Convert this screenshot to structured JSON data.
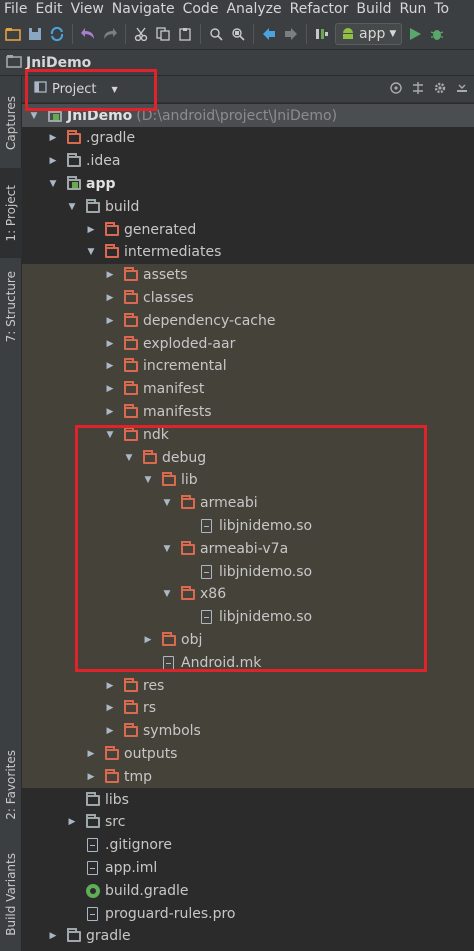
{
  "menu": [
    "File",
    "Edit",
    "View",
    "Navigate",
    "Code",
    "Analyze",
    "Refactor",
    "Build",
    "Run",
    "To"
  ],
  "toolbar": {
    "run_config": "app"
  },
  "breadcrumb": {
    "project": "JniDemo"
  },
  "left_tabs": {
    "captures": "Captures",
    "project": "1: Project",
    "structure": "7: Structure",
    "favorites": "2: Favorites",
    "build_variants": "Build Variants"
  },
  "panel": {
    "view_selector": "Project"
  },
  "tree": [
    {
      "label": "JniDemo",
      "path": "(D:\\android\\project\\JniDemo)",
      "depth": 0,
      "expanded": true,
      "icon": "module-folder",
      "bold": true,
      "sel": true
    },
    {
      "label": ".gradle",
      "depth": 1,
      "expanded": false,
      "icon": "folder"
    },
    {
      "label": ".idea",
      "depth": 1,
      "expanded": false,
      "icon": "grey-folder"
    },
    {
      "label": "app",
      "depth": 1,
      "expanded": true,
      "icon": "module-folder",
      "bold": true
    },
    {
      "label": "build",
      "depth": 2,
      "expanded": true,
      "icon": "grey-folder"
    },
    {
      "label": "generated",
      "depth": 3,
      "expanded": false,
      "icon": "folder"
    },
    {
      "label": "intermediates",
      "depth": 3,
      "expanded": true,
      "icon": "folder"
    },
    {
      "label": "assets",
      "depth": 4,
      "expanded": false,
      "icon": "folder",
      "hl": true
    },
    {
      "label": "classes",
      "depth": 4,
      "expanded": false,
      "icon": "folder",
      "hl": true
    },
    {
      "label": "dependency-cache",
      "depth": 4,
      "expanded": false,
      "icon": "folder",
      "hl": true
    },
    {
      "label": "exploded-aar",
      "depth": 4,
      "expanded": false,
      "icon": "folder",
      "hl": true
    },
    {
      "label": "incremental",
      "depth": 4,
      "expanded": false,
      "icon": "folder",
      "hl": true
    },
    {
      "label": "manifest",
      "depth": 4,
      "expanded": false,
      "icon": "folder",
      "hl": true
    },
    {
      "label": "manifests",
      "depth": 4,
      "expanded": false,
      "icon": "folder",
      "hl": true
    },
    {
      "label": "ndk",
      "depth": 4,
      "expanded": true,
      "icon": "folder",
      "hl": true
    },
    {
      "label": "debug",
      "depth": 5,
      "expanded": true,
      "icon": "folder",
      "hl": true
    },
    {
      "label": "lib",
      "depth": 6,
      "expanded": true,
      "icon": "folder",
      "hl": true
    },
    {
      "label": "armeabi",
      "depth": 7,
      "expanded": true,
      "icon": "folder",
      "hl": true
    },
    {
      "label": "libjnidemo.so",
      "depth": 8,
      "icon": "file",
      "hl": true
    },
    {
      "label": "armeabi-v7a",
      "depth": 7,
      "expanded": true,
      "icon": "folder",
      "hl": true
    },
    {
      "label": "libjnidemo.so",
      "depth": 8,
      "icon": "file",
      "hl": true
    },
    {
      "label": "x86",
      "depth": 7,
      "expanded": true,
      "icon": "folder",
      "hl": true
    },
    {
      "label": "libjnidemo.so",
      "depth": 8,
      "icon": "file",
      "hl": true
    },
    {
      "label": "obj",
      "depth": 6,
      "expanded": false,
      "icon": "folder",
      "hl": true
    },
    {
      "label": "Android.mk",
      "depth": 6,
      "icon": "file",
      "hl": true
    },
    {
      "label": "res",
      "depth": 4,
      "expanded": false,
      "icon": "folder",
      "hl": true
    },
    {
      "label": "rs",
      "depth": 4,
      "expanded": false,
      "icon": "folder",
      "hl": true
    },
    {
      "label": "symbols",
      "depth": 4,
      "expanded": false,
      "icon": "folder",
      "hl": true
    },
    {
      "label": "outputs",
      "depth": 3,
      "expanded": false,
      "icon": "folder",
      "hl": true
    },
    {
      "label": "tmp",
      "depth": 3,
      "expanded": false,
      "icon": "folder",
      "hl": true
    },
    {
      "label": "libs",
      "depth": 2,
      "icon": "grey-folder"
    },
    {
      "label": "src",
      "depth": 2,
      "expanded": false,
      "icon": "grey-folder"
    },
    {
      "label": ".gitignore",
      "depth": 2,
      "icon": "file"
    },
    {
      "label": "app.iml",
      "depth": 2,
      "icon": "file"
    },
    {
      "label": "build.gradle",
      "depth": 2,
      "icon": "gradle"
    },
    {
      "label": "proguard-rules.pro",
      "depth": 2,
      "icon": "file"
    },
    {
      "label": "gradle",
      "depth": 1,
      "expanded": false,
      "icon": "grey-folder"
    }
  ]
}
